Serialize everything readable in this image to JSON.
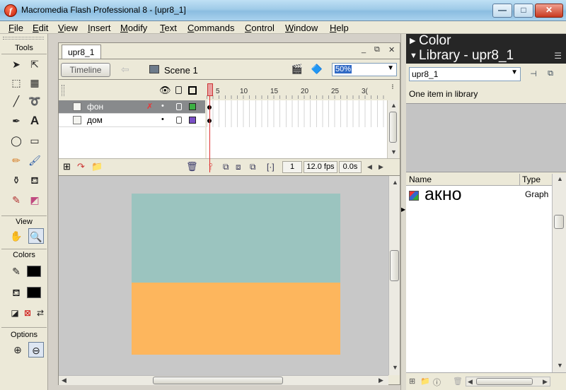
{
  "window": {
    "title": "Macromedia Flash Professional 8 - [upr8_1]"
  },
  "menu": [
    {
      "underline": "F",
      "rest": "ile"
    },
    {
      "underline": "E",
      "rest": "dit"
    },
    {
      "underline": "V",
      "rest": "iew"
    },
    {
      "underline": "I",
      "rest": "nsert"
    },
    {
      "underline": "M",
      "rest": "odify"
    },
    {
      "underline": "T",
      "rest": "ext"
    },
    {
      "underline": "C",
      "rest": "ommands"
    },
    {
      "underline": "C",
      "rest": "ontrol"
    },
    {
      "underline": "W",
      "rest": "indow"
    },
    {
      "underline": "H",
      "rest": "elp"
    }
  ],
  "tools": {
    "title": "Tools",
    "view_label": "View",
    "colors_label": "Colors",
    "options_label": "Options"
  },
  "document": {
    "tab": "upr8_1",
    "timeline_button": "Timeline",
    "scene": "Scene 1",
    "zoom": "50%"
  },
  "timeline": {
    "ruler": [
      "1",
      "5",
      "10",
      "15",
      "20",
      "25",
      "3("
    ],
    "layers": [
      {
        "name": "фон",
        "color": "#3cb043",
        "selected": true
      },
      {
        "name": "дом",
        "color": "#7a4fc6",
        "selected": false
      }
    ],
    "frame": "1",
    "fps": "12.0 fps",
    "time": "0.0s"
  },
  "stage": {
    "top_color": "#9bc4bf",
    "bottom_color": "#fdb65d"
  },
  "panels": {
    "color_title": "Color",
    "library_title": "Library - upr8_1"
  },
  "library": {
    "document": "upr8_1",
    "count_text": "One item in library",
    "columns": {
      "name": "Name",
      "type": "Type"
    },
    "items": [
      {
        "name": "акно",
        "type": "Graph"
      }
    ]
  }
}
